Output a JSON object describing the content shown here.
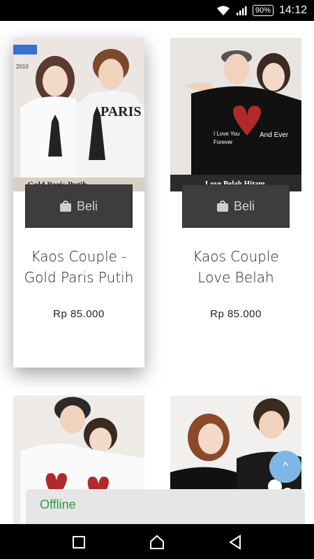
{
  "status_bar": {
    "battery": "90%",
    "time": "14:12",
    "icons": [
      "wifi-icon",
      "signal-icon",
      "battery-icon"
    ]
  },
  "products": [
    {
      "title_line1": "Kaos Couple -",
      "title_line2": "Gold Paris Putih",
      "price": "Rp 85.000",
      "button": "Beli",
      "image_caption": "Gold Paris Putih",
      "image_corner": "2010"
    },
    {
      "title_line1": "Kaos Couple",
      "title_line2": "Love Belah",
      "price": "Rp 85.000",
      "button": "Beli",
      "image_caption": "Love Belah Hitam",
      "shirt_text_left": "I Love You Forever",
      "shirt_text_right": "And Ever"
    },
    {
      "image_only": true
    },
    {
      "image_only": true
    }
  ],
  "fab": {
    "icon": "chevron-up-icon",
    "glyph": "^"
  },
  "offline": {
    "label": "Offline"
  },
  "nav": {
    "icons": [
      "recent-apps-icon",
      "home-icon",
      "back-icon"
    ]
  },
  "colors": {
    "button_bg": "#3d3d3d",
    "fab": "#7fb6e6",
    "offline_text": "#2e9b3e"
  }
}
